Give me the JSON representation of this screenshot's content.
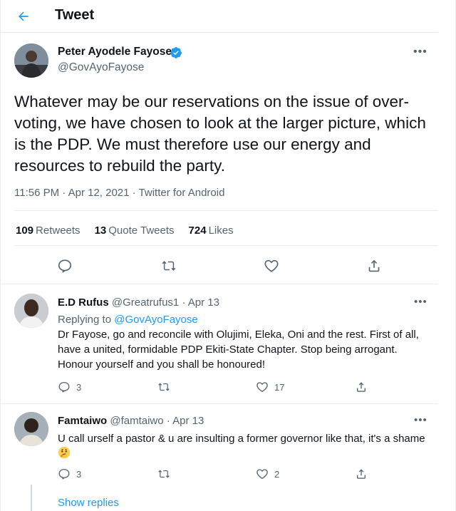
{
  "header": {
    "title": "Tweet"
  },
  "main_tweet": {
    "author_name": "Peter Ayodele Fayose",
    "author_handle": "@GovAyoFayose",
    "text": "Whatever may be our reservations on the issue of over-voting, we have chosen to look at the larger picture, which is the PDP.  We must therefore use our energy and resources to rebuild the party.",
    "meta": "11:56 PM · Apr 12, 2021 · Twitter for Android",
    "stats": [
      {
        "count": "109",
        "label": "Retweets"
      },
      {
        "count": "13",
        "label": "Quote Tweets"
      },
      {
        "count": "724",
        "label": "Likes"
      }
    ],
    "actions": [
      "reply-icon",
      "retweet-icon",
      "like-icon",
      "share-icon"
    ]
  },
  "replies": [
    {
      "name": "E.D Rufus",
      "handle_time": "@Greatrufus1 · Apr 13",
      "replying_prefix": "Replying to ",
      "replying_to": "@GovAyoFayose",
      "text": "Dr Fayose, go and reconcile with Olujimi, Eleka, Oni and the rest. First of all, have a united, formidable PDP Ekiti-State Chapter. Stop being arrogant. Honour yourself and you shall be honoured!",
      "reply_count": "3",
      "retweet_count": "",
      "like_count": "17"
    },
    {
      "name": "Famtaiwo",
      "handle_time": "@famtaiwo · Apr 13",
      "text": "U call urself a pastor & u are insulting a former governor like that, it's a shame",
      "emoji": "thinking-face-icon",
      "reply_count": "3",
      "retweet_count": "",
      "like_count": "2"
    }
  ],
  "show_replies": "Show replies",
  "colors": {
    "accent": "#1d9bf0",
    "secondary_text": "#536471",
    "divider": "#e6ecf0"
  }
}
